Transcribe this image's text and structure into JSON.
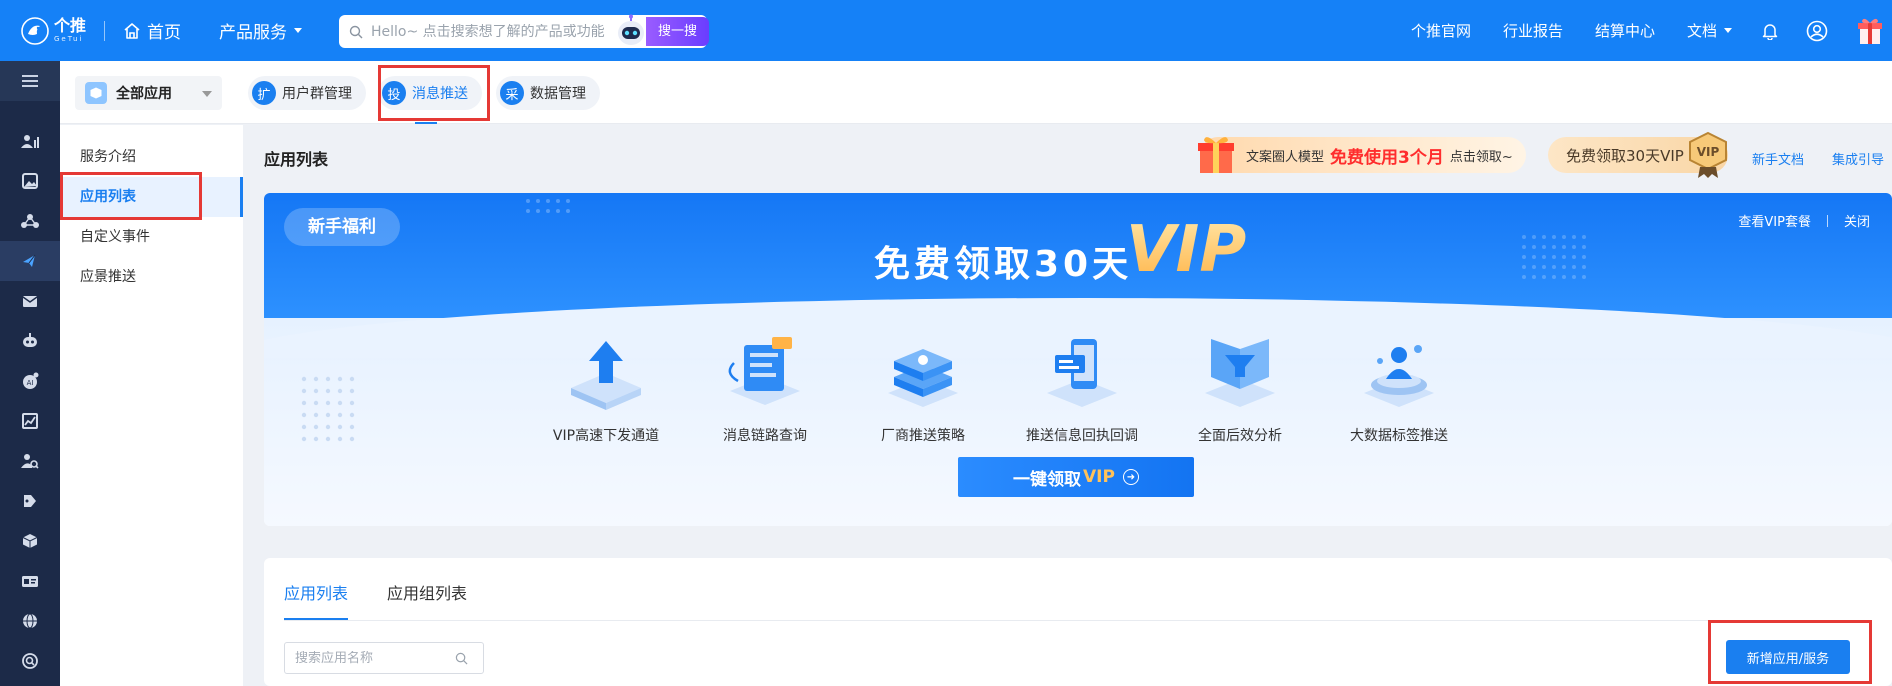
{
  "topbar": {
    "logo_text": "个推",
    "logo_sub": "GeTui",
    "home_label": "首页",
    "products_label": "产品服务",
    "search_placeholder": "Hello~ 点击搜索想了解的产品或功能",
    "search_button": "搜一搜",
    "links": [
      "个推官网",
      "行业报告",
      "结算中心"
    ],
    "docs_label": "文档"
  },
  "rail": {
    "icons": [
      "users-icon",
      "image-icon",
      "share-icon",
      "push-icon",
      "mail-icon",
      "robot-icon",
      "ai-icon",
      "chart-icon",
      "user-search-icon",
      "tag-icon",
      "box-icon",
      "card-icon",
      "globe-icon",
      "search-circle-icon"
    ],
    "active_index": 3
  },
  "subbar": {
    "app_select_label": "全部应用",
    "tabs": [
      {
        "badge": "扩",
        "label": "用户群管理"
      },
      {
        "badge": "投",
        "label": "消息推送"
      },
      {
        "badge": "采",
        "label": "数据管理"
      }
    ],
    "active_tab": 1
  },
  "sidenav": {
    "items": [
      "服务介绍",
      "应用列表",
      "自定义事件",
      "应景推送"
    ],
    "active_index": 1
  },
  "header": {
    "title": "应用列表",
    "promo_llm_prefix": "文案圈人模型",
    "promo_llm_hot": "免费使用3个月",
    "promo_llm_suffix": "点击领取~",
    "promo_vip": "免费领取30天VIP",
    "link_newbie_docs": "新手文档",
    "link_integration": "集成引导"
  },
  "vip_banner": {
    "tag": "新手福利",
    "title": "免费领取30天",
    "title_vip": "VIP",
    "view_packages": "查看VIP套餐",
    "close": "关闭",
    "features": [
      "VIP高速下发通道",
      "消息链路查询",
      "厂商推送策略",
      "推送信息回执回调",
      "全面后效分析",
      "大数据标签推送"
    ],
    "claim_prefix": "一键领取",
    "claim_vip": "VIP"
  },
  "app_list": {
    "tabs": [
      "应用列表",
      "应用组列表"
    ],
    "active_tab": 0,
    "search_placeholder": "搜索应用名称",
    "add_button": "新增应用/服务"
  },
  "colors": {
    "brand": "#1581f7",
    "rail_bg": "#1c2a48",
    "highlight_box": "#e53935",
    "promo_hot": "#ff2d2d"
  }
}
